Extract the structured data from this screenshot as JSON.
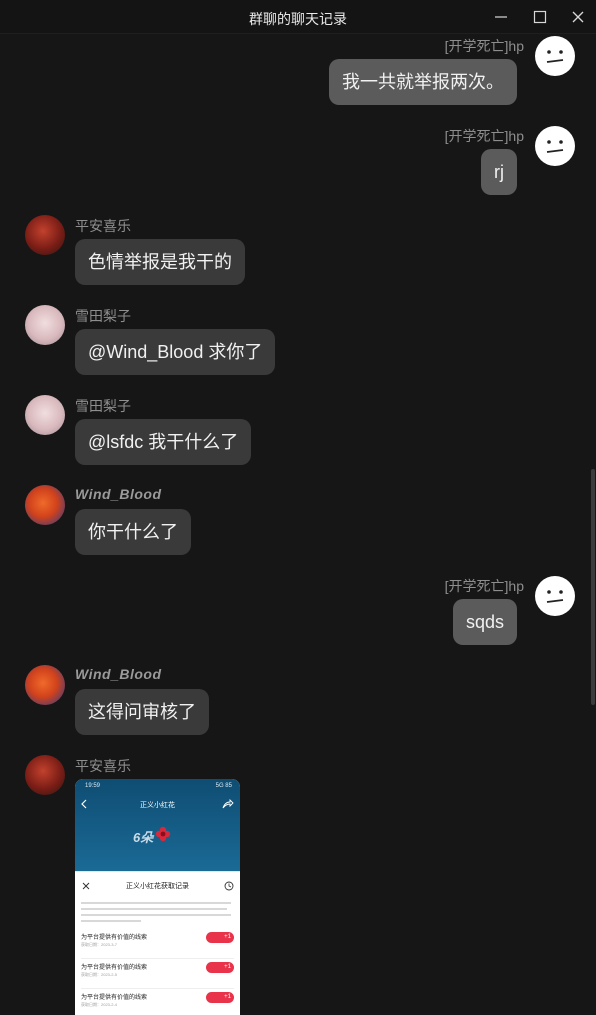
{
  "window": {
    "title": "群聊的聊天记录"
  },
  "messages": [
    {
      "sender": "[开学死亡]hp",
      "text": "我一共就举报两次。",
      "side": "self",
      "avatar": "meh-face-icon"
    },
    {
      "sender": "[开学死亡]hp",
      "text": "rj",
      "side": "self",
      "avatar": "meh-face-icon"
    },
    {
      "sender": "平安喜乐",
      "text": "色情举报是我干的",
      "side": "other",
      "avatar": "red-character-avatar"
    },
    {
      "sender": "雪田梨子",
      "text": "@Wind_Blood 求你了",
      "side": "other",
      "avatar": "pale-character-avatar"
    },
    {
      "sender": "雪田梨子",
      "text": "@lsfdc 我干什么了",
      "side": "other",
      "avatar": "pale-character-avatar"
    },
    {
      "sender": "Wind_Blood",
      "text": "你干什么了",
      "side": "other",
      "avatar": "orange-hair-avatar"
    },
    {
      "sender": "[开学死亡]hp",
      "text": "sqds",
      "side": "self",
      "avatar": "meh-face-icon"
    },
    {
      "sender": "Wind_Blood",
      "text": "这得问审核了",
      "side": "other",
      "avatar": "orange-hair-avatar"
    },
    {
      "sender": "平安喜乐",
      "text": "",
      "side": "other",
      "avatar": "red-character-avatar"
    }
  ],
  "image_message": {
    "status_time": "19:59",
    "status_right": "5G 85",
    "header": "正义小红花",
    "count": "6朵",
    "sheet_title": "正义小红花获取记录",
    "rows": [
      {
        "title": "为平台提供有价值的线索",
        "date": "获取日期：2023-3-7",
        "badge": "+1"
      },
      {
        "title": "为平台提供有价值的线索",
        "date": "获取日期：2023-2-5",
        "badge": "+1"
      },
      {
        "title": "为平台提供有价值的线索",
        "date": "获取日期：2023-2-4",
        "badge": "+1"
      }
    ]
  },
  "colors": {
    "background": "#161616",
    "other_bubble": "#3a3a3a",
    "self_bubble": "#5b5b5b",
    "badge": "#e8334a"
  }
}
